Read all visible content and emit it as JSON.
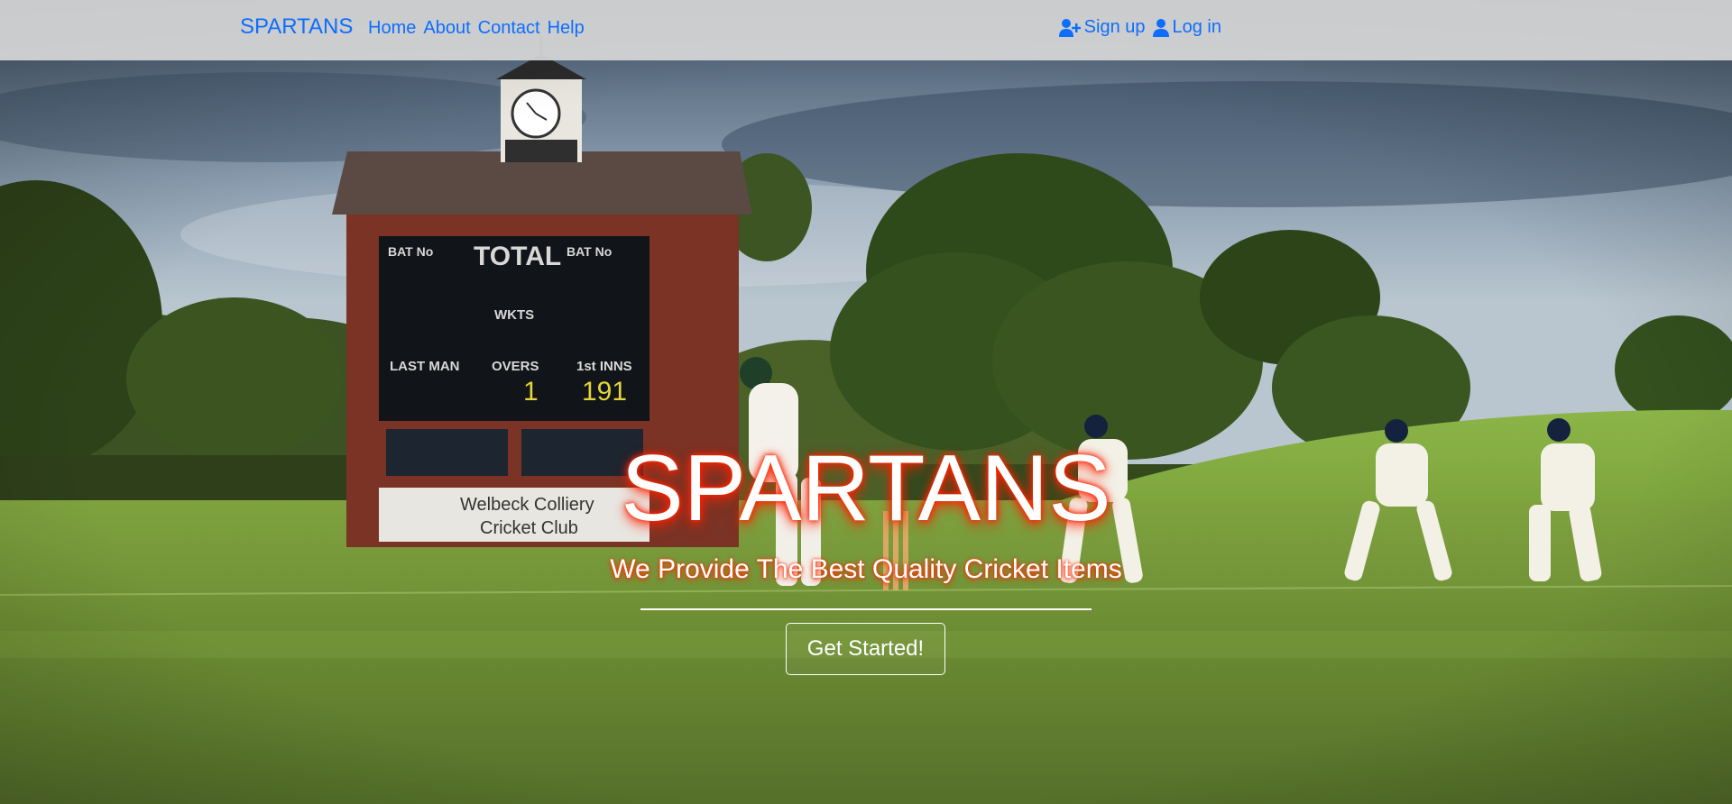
{
  "navbar": {
    "brand": "SPARTANS",
    "links": [
      "Home",
      "About",
      "Contact",
      "Help"
    ],
    "signup_label": "Sign up",
    "login_label": "Log in",
    "signup_icon": "user-plus-icon",
    "login_icon": "user-icon",
    "link_color": "#0d6efd"
  },
  "hero": {
    "title": "SPARTANS",
    "subtitle": "We Provide The Best Quality Cricket Items",
    "cta_label": "Get Started!",
    "title_glow_color": "#ff2a00",
    "scoreboard": {
      "headings": [
        "BAT No",
        "TOTAL",
        "BAT No",
        "WKTS",
        "LAST MAN",
        "OVERS",
        "1st INNS"
      ],
      "overs_value": "1",
      "first_inns_value": "191",
      "sign_line1": "Welbeck Colliery",
      "sign_line2": "Cricket Club"
    }
  }
}
